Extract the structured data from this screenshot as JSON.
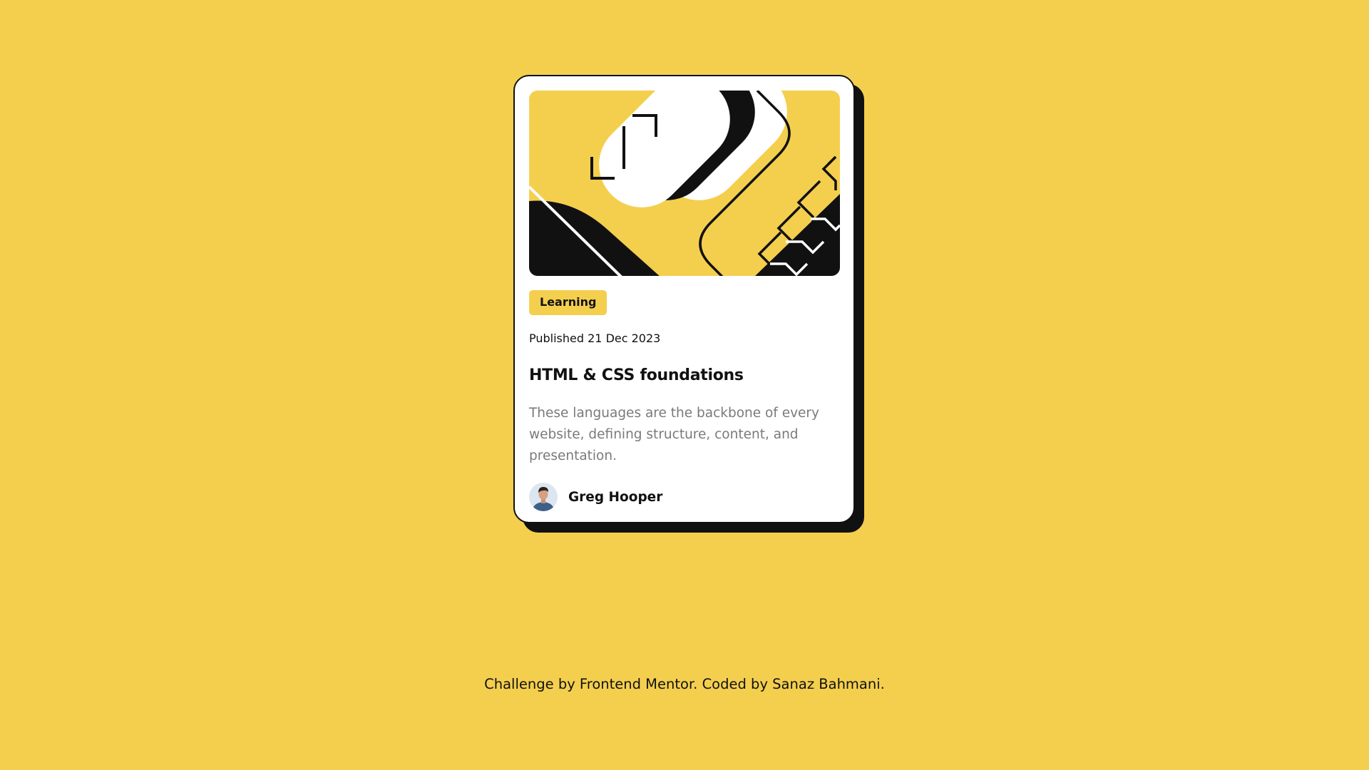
{
  "colors": {
    "background": "#F4CF4E",
    "card": "#FFFFFF",
    "ink": "#111111",
    "muted": "#7A7A7A",
    "tag": "#F4CF4E"
  },
  "card": {
    "hero_image": "illustration-article",
    "tag": "Learning",
    "published": "Published 21 Dec 2023",
    "title": "HTML & CSS foundations",
    "description": "These languages are the backbone of every website, defining structure, content, and presentation.",
    "author": {
      "avatar": "avatar-icon",
      "name": "Greg Hooper"
    }
  },
  "footer": {
    "text": "Challenge by Frontend Mentor. Coded by Sanaz Bahmani."
  }
}
